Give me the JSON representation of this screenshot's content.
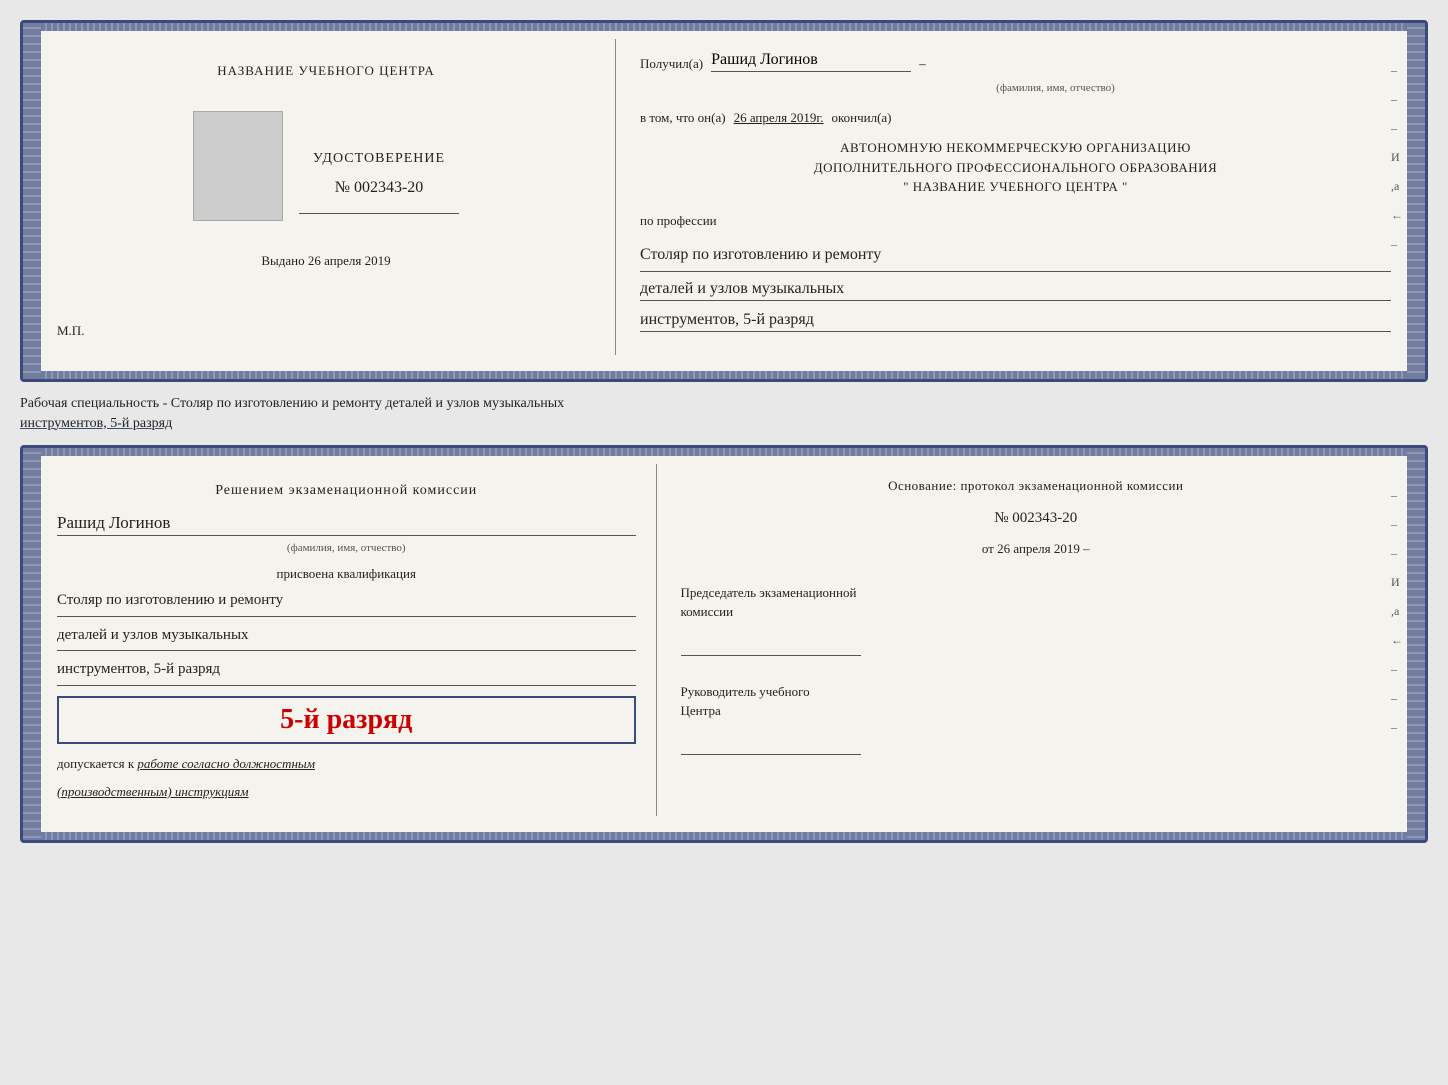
{
  "doc1": {
    "left": {
      "center_name": "НАЗВАНИЕ УЧЕБНОГО ЦЕНТРА",
      "cert_label": "УДОСТОВЕРЕНИЕ",
      "cert_number": "№ 002343-20",
      "issued_label": "Выдано",
      "issued_date": "26 апреля 2019",
      "mp_label": "М.П."
    },
    "right": {
      "received_label": "Получил(а)",
      "recipient_name": "Рашид Логинов",
      "name_subtitle": "(фамилия, имя, отчество)",
      "dash": "–",
      "certified_label": "в том, что он(а)",
      "certified_date": "26 апреля 2019г.",
      "completed_label": "окончил(а)",
      "org_line1": "АВТОНОМНУЮ НЕКОММЕРЧЕСКУЮ ОРГАНИЗАЦИЮ",
      "org_line2": "ДОПОЛНИТЕЛЬНОГО ПРОФЕССИОНАЛЬНОГО ОБРАЗОВАНИЯ",
      "org_line3": "\"  НАЗВАНИЕ УЧЕБНОГО ЦЕНТРА  \"",
      "profession_label": "по профессии",
      "profession_line1": "Столяр по изготовлению и ремонту",
      "profession_line2": "деталей и узлов музыкальных",
      "profession_line3": "инструментов, 5-й разряд"
    },
    "side_marks": [
      "–",
      "–",
      "–",
      "И",
      ",а",
      "←",
      "–"
    ]
  },
  "specialty_label": "Рабочая специальность - Столяр по изготовлению и ремонту деталей и узлов музыкальных",
  "specialty_label2": "инструментов, 5-й разряд",
  "doc2": {
    "left": {
      "decision_line1": "Решением  экзаменационной  комиссии",
      "person_name": "Рашид Логинов",
      "name_subtitle": "(фамилия, имя, отчество)",
      "qualification_label": "присвоена квалификация",
      "qual_line1": "Столяр по изготовлению и ремонту",
      "qual_line2": "деталей и узлов музыкальных",
      "qual_line3": "инструментов, 5-й разряд",
      "rank_text": "5-й разряд",
      "admitted_label": "допускается к",
      "admitted_text": "работе согласно должностным",
      "admitted_text2": "(производственным) инструкциям"
    },
    "right": {
      "basis_line1": "Основание: протокол экзаменационной комиссии",
      "protocol_number": "№  002343-20",
      "from_label": "от",
      "from_date": "26 апреля 2019",
      "chairman_line1": "Председатель экзаменационной",
      "chairman_line2": "комиссии",
      "director_line1": "Руководитель учебного",
      "director_line2": "Центра"
    },
    "side_marks": [
      "–",
      "–",
      "–",
      "И",
      ",а",
      "←",
      "–",
      "–",
      "–"
    ]
  }
}
